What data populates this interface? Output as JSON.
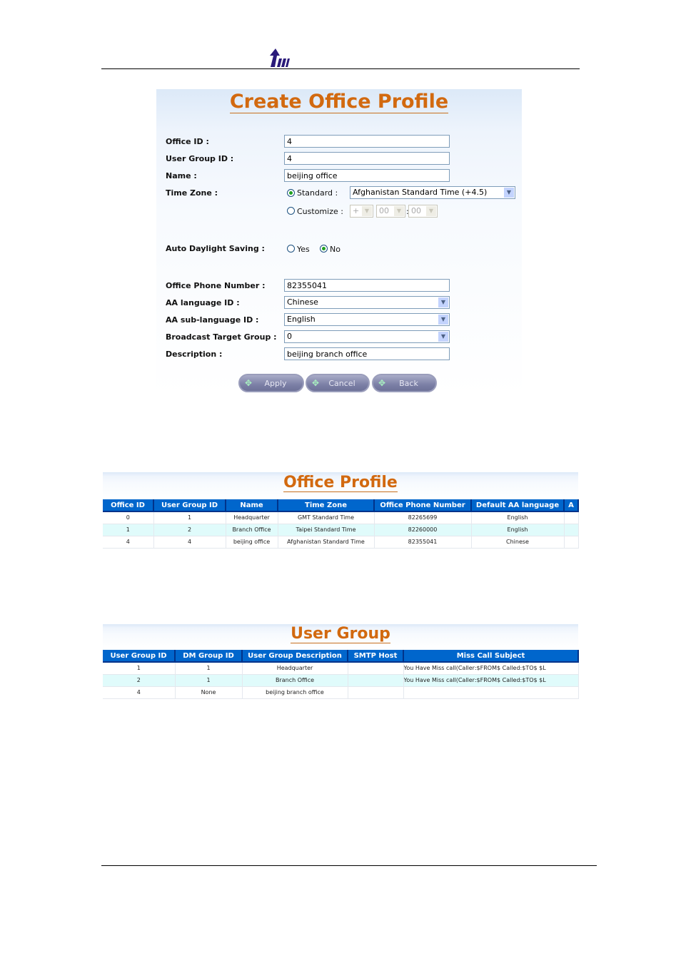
{
  "header": {
    "logo": "tw"
  },
  "form": {
    "title": "Create Office Profile",
    "fields": {
      "office_id": {
        "label": "Office ID :",
        "value": "4"
      },
      "user_group_id": {
        "label": "User Group ID :",
        "value": "4"
      },
      "name": {
        "label": "Name :",
        "value": "beijing office"
      },
      "time_zone": {
        "label": "Time Zone :",
        "standard_label": "Standard :",
        "standard_value": "Afghanistan Standard Time (+4.5)",
        "customize_label": "Customize :",
        "sign": "+",
        "hours": "00",
        "minutes": "00",
        "separator": ":",
        "selected": "Standard"
      },
      "auto_daylight": {
        "label": "Auto Daylight Saving :",
        "yes": "Yes",
        "no": "No",
        "selected": "No"
      },
      "phone": {
        "label": "Office Phone Number :",
        "value": "82355041"
      },
      "aa_language": {
        "label": "AA language ID :",
        "value": "Chinese"
      },
      "aa_sub_language": {
        "label": "AA sub-language ID :",
        "value": "English"
      },
      "broadcast": {
        "label": "Broadcast Target Group :",
        "value": "0"
      },
      "description": {
        "label": "Description :",
        "value": "beijing branch office"
      }
    },
    "buttons": {
      "apply": "Apply",
      "cancel": "Cancel",
      "back": "Back"
    }
  },
  "office_table": {
    "title": "Office Profile",
    "headers": [
      "Office ID",
      "User Group ID",
      "Name",
      "Time Zone",
      "Office Phone Number",
      "Default AA language",
      "A"
    ],
    "rows": [
      [
        "0",
        "1",
        "Headquarter",
        "GMT Standard Time",
        "82265699",
        "English",
        ""
      ],
      [
        "1",
        "2",
        "Branch Office",
        "Taipei Standard Time",
        "82260000",
        "English",
        ""
      ],
      [
        "4",
        "4",
        "beijing office",
        "Afghanistan Standard Time",
        "82355041",
        "Chinese",
        ""
      ]
    ]
  },
  "group_table": {
    "title": "User Group",
    "headers": [
      "User Group ID",
      "DM Group ID",
      "User Group Description",
      "SMTP Host",
      "Miss Call Subject"
    ],
    "rows": [
      [
        "1",
        "1",
        "Headquarter",
        "",
        "You Have Miss call(Caller:$FROM$ Called:$TO$ $L"
      ],
      [
        "2",
        "1",
        "Branch Office",
        "",
        "You Have Miss call(Caller:$FROM$ Called:$TO$ $L"
      ],
      [
        "4",
        "None",
        "beijing branch office",
        "",
        ""
      ]
    ]
  },
  "colors": {
    "title": "#d2690f",
    "table_header": "#0066cc",
    "alt_row": "#e0fbfb"
  }
}
